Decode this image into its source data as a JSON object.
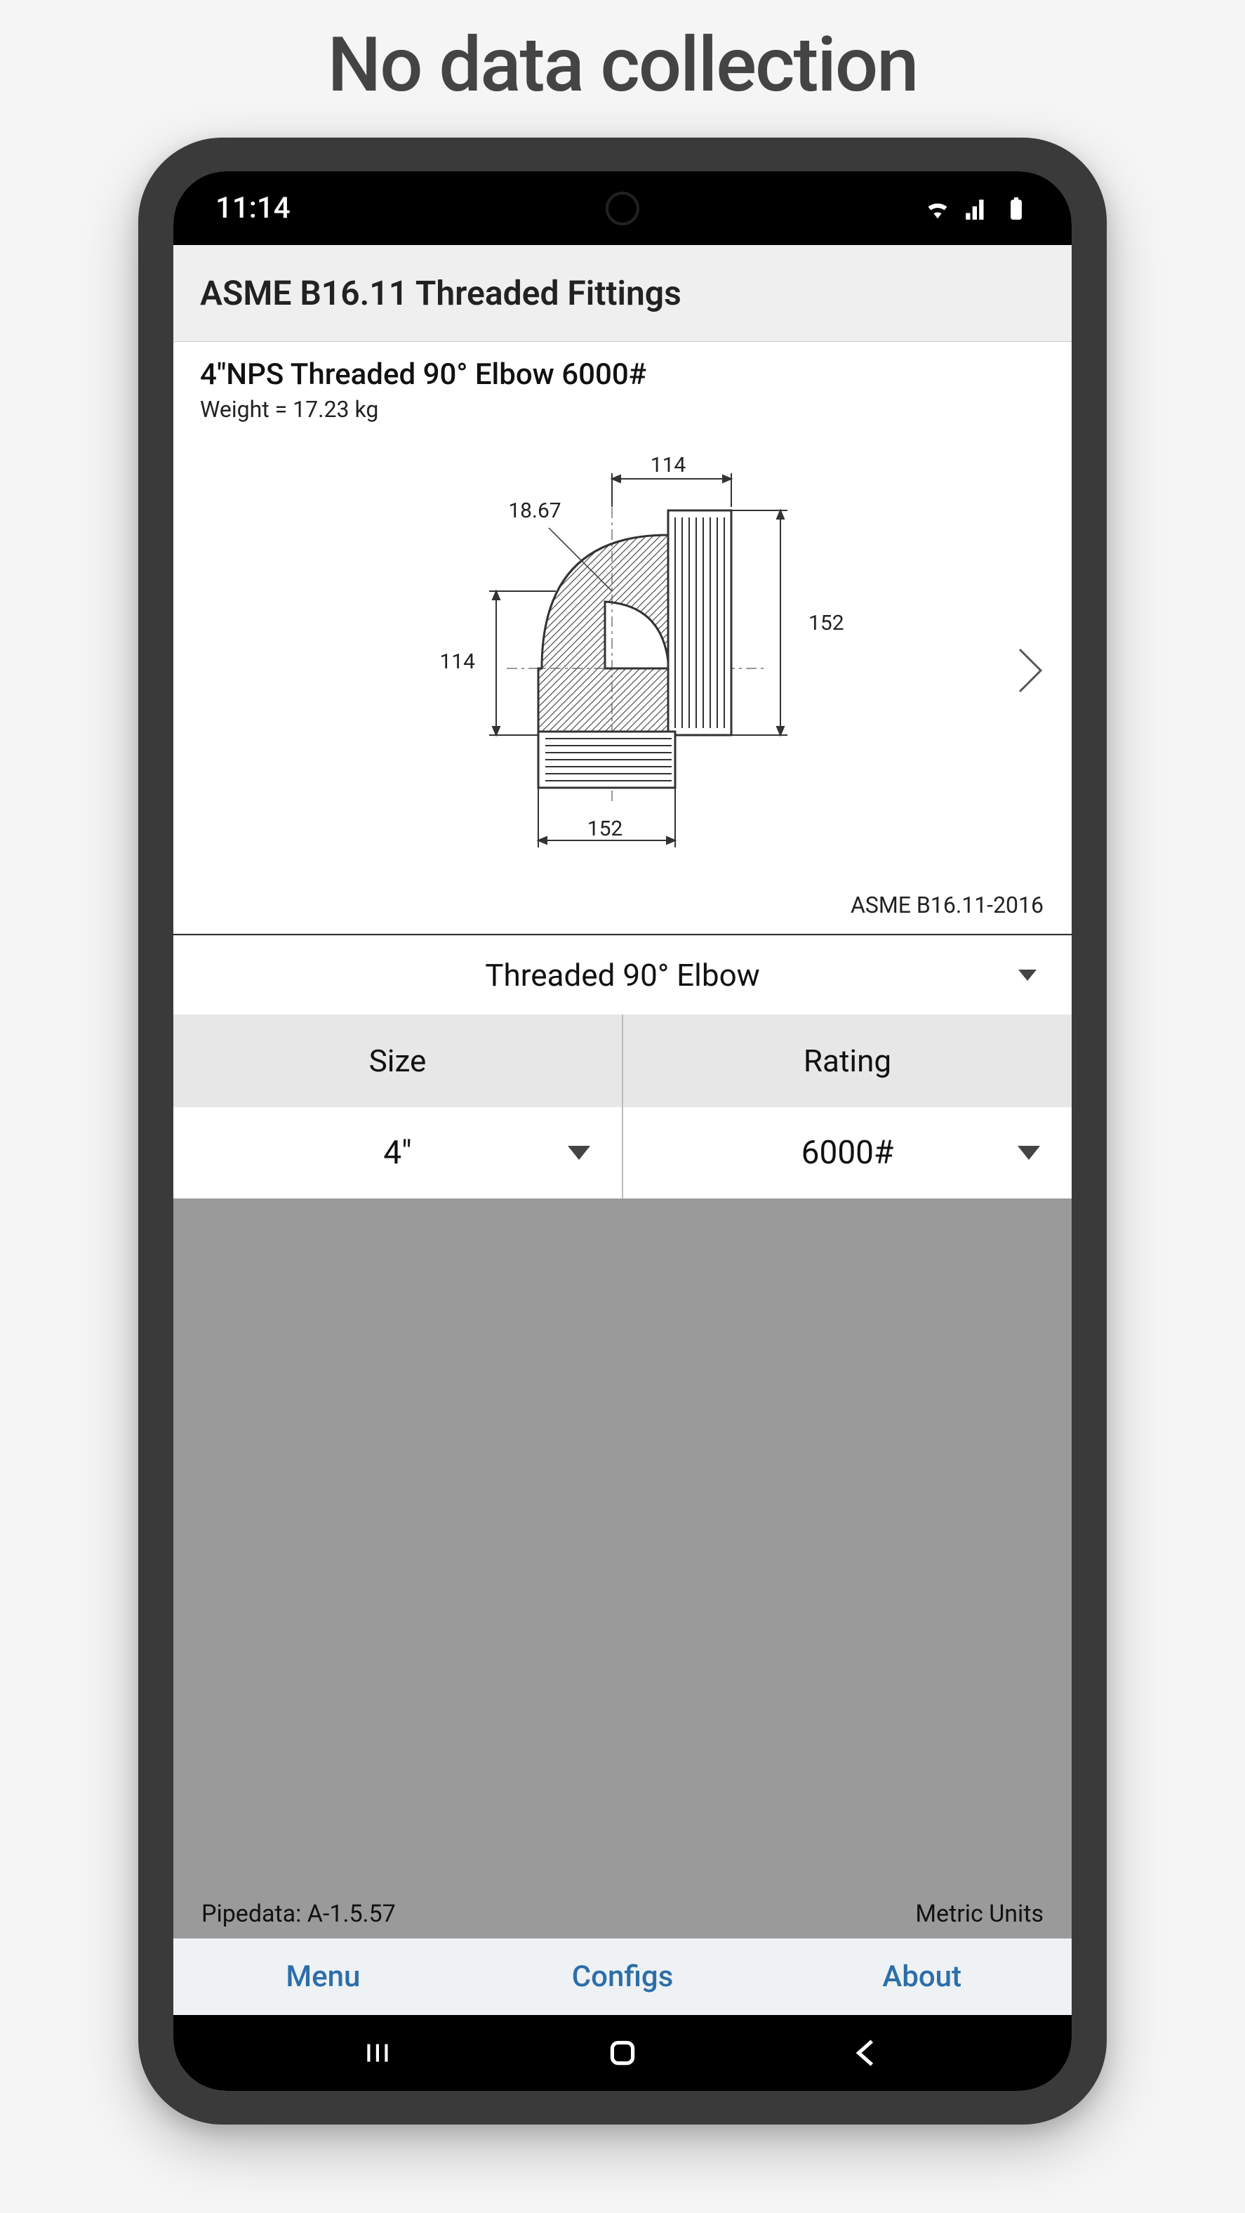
{
  "headline": "No data collection",
  "status": {
    "time": "11:14"
  },
  "header": {
    "title": "ASME B16.11 Threaded Fittings"
  },
  "item": {
    "title": "4\"NPS Threaded 90° Elbow 6000#",
    "weight": "Weight = 17.23 kg",
    "spec": "ASME B16.11-2016"
  },
  "diagram": {
    "dim_top": "114",
    "dim_angle": "18.67",
    "dim_right": "152",
    "dim_left": "114",
    "dim_bottom": "152"
  },
  "type_selector": {
    "label": "Threaded 90° Elbow"
  },
  "pickers": {
    "size": {
      "header": "Size",
      "value": "4\""
    },
    "rating": {
      "header": "Rating",
      "value": "6000#"
    }
  },
  "footer": {
    "version": "Pipedata: A-1.5.57",
    "units": "Metric Units"
  },
  "tabs": {
    "menu": "Menu",
    "configs": "Configs",
    "about": "About"
  }
}
